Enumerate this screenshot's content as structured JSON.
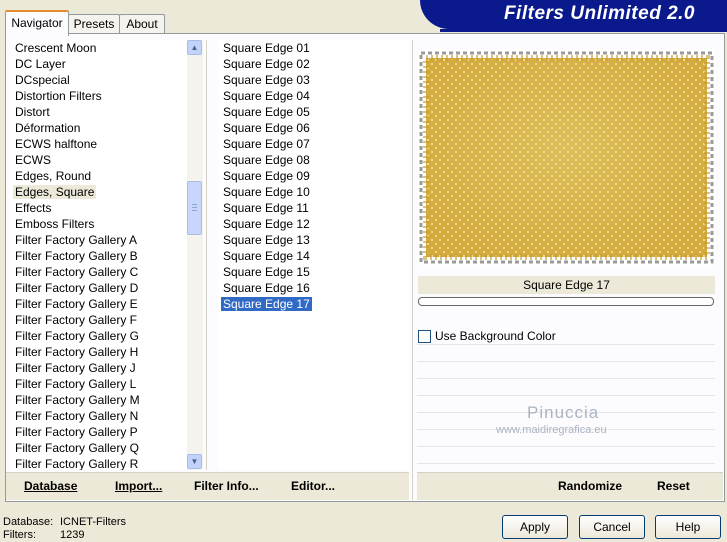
{
  "tabs": [
    {
      "label": "Navigator"
    },
    {
      "label": "Presets"
    },
    {
      "label": "About"
    }
  ],
  "header": {
    "title": "Filters Unlimited 2.0"
  },
  "categories": {
    "items": [
      "Crescent Moon",
      "DC Layer",
      "DCspecial",
      "Distortion Filters",
      "Distort",
      "Déformation",
      "ECWS halftone",
      "ECWS",
      "Edges, Round",
      "Edges, Square",
      "Effects",
      "Emboss Filters",
      "Filter Factory Gallery A",
      "Filter Factory Gallery B",
      "Filter Factory Gallery C",
      "Filter Factory Gallery D",
      "Filter Factory Gallery E",
      "Filter Factory Gallery F",
      "Filter Factory Gallery G",
      "Filter Factory Gallery H",
      "Filter Factory Gallery J",
      "Filter Factory Gallery L",
      "Filter Factory Gallery M",
      "Filter Factory Gallery N",
      "Filter Factory Gallery P",
      "Filter Factory Gallery Q",
      "Filter Factory Gallery R"
    ],
    "selected": "Edges, Square"
  },
  "filters": {
    "items": [
      "Square Edge 01",
      "Square Edge 02",
      "Square Edge 03",
      "Square Edge 04",
      "Square Edge 05",
      "Square Edge 06",
      "Square Edge 07",
      "Square Edge 08",
      "Square Edge 09",
      "Square Edge 10",
      "Square Edge 11",
      "Square Edge 12",
      "Square Edge 13",
      "Square Edge 14",
      "Square Edge 15",
      "Square Edge 16",
      "Square Edge 17"
    ],
    "selected": "Square Edge 17"
  },
  "preview": {
    "caption": "Square Edge 17",
    "colors": {
      "base": "#d6b040",
      "light": "#e2c46a",
      "dark": "#c49a28"
    }
  },
  "options": {
    "use_background_color_label": "Use Background Color",
    "use_background_color_checked": false
  },
  "watermark": {
    "name": "Pinuccia",
    "site": "www.maidiregrafica.eu"
  },
  "toolbar": {
    "database_label": "Database",
    "import_label": "Import...",
    "filter_info_label": "Filter Info...",
    "editor_label": "Editor...",
    "randomize_label": "Randomize",
    "reset_label": "Reset"
  },
  "status": {
    "database_label": "Database:",
    "database_value": "ICNET-Filters",
    "filters_label": "Filters:",
    "filters_value": "1239"
  },
  "dialog_buttons": {
    "apply": "Apply",
    "cancel": "Cancel",
    "help": "Help"
  }
}
